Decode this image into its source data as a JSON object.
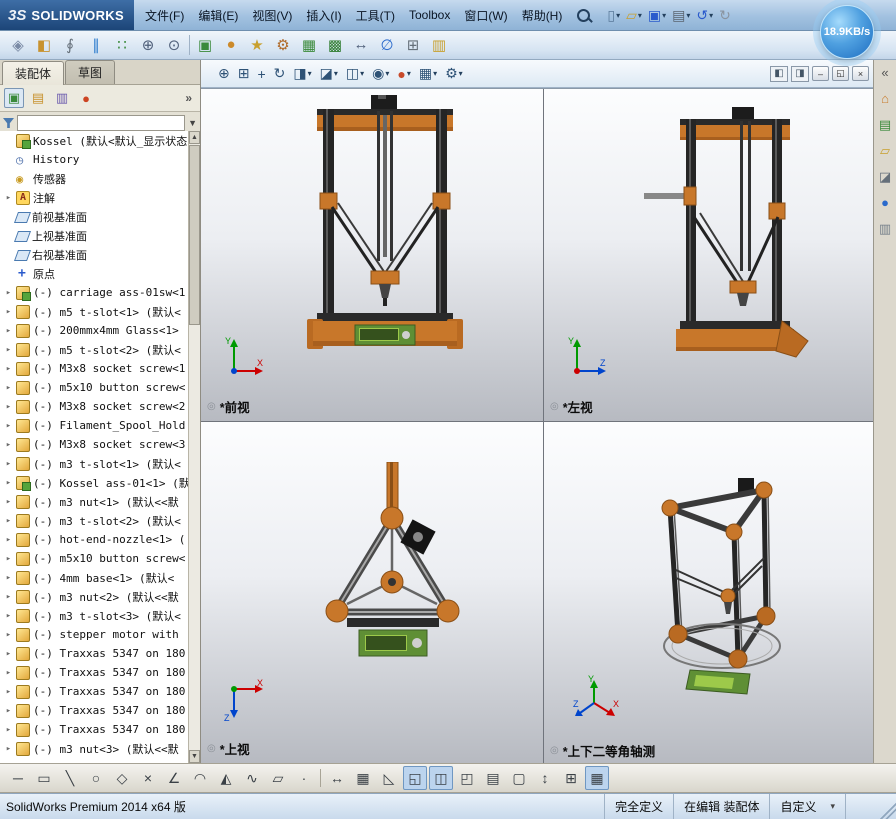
{
  "titlebar": {
    "logo_mark": "3S",
    "logo_text": "SOLIDWORKS",
    "menus": [
      "文件(F)",
      "编辑(E)",
      "视图(V)",
      "插入(I)",
      "工具(T)",
      "Toolbox",
      "窗口(W)",
      "帮助(H)"
    ],
    "quick_icons": [
      {
        "name": "new-document-icon",
        "glyph": "▯",
        "color": "#5a7a9a",
        "caret": true
      },
      {
        "name": "open-icon",
        "glyph": "▱",
        "color": "#c8a02e",
        "caret": true
      },
      {
        "name": "save-icon",
        "glyph": "▣",
        "color": "#2a5acc",
        "caret": true
      },
      {
        "name": "print-icon",
        "glyph": "▤",
        "color": "#5a6470",
        "caret": true
      },
      {
        "name": "undo-icon",
        "glyph": "↺",
        "color": "#2a5acc",
        "caret": true
      },
      {
        "name": "redo-icon",
        "glyph": "↻",
        "color": "#8a94a0",
        "caret": false
      }
    ],
    "speed_badge": "18.9KB/s"
  },
  "main_toolbar": {
    "icons": [
      {
        "name": "smart-explode-icon",
        "glyph": "◈",
        "color": "#7a8aa5"
      },
      {
        "name": "edit-component-icon",
        "glyph": "◧",
        "color": "#c8922e"
      },
      {
        "name": "paperclip-icon",
        "glyph": "∮",
        "color": "#66707a"
      },
      {
        "name": "mate-icon",
        "glyph": "∥",
        "color": "#2a7acc"
      },
      {
        "name": "component-pattern-icon",
        "glyph": "∷",
        "color": "#3a8a3a"
      },
      {
        "name": "magnifier-plus-icon",
        "glyph": "⊕",
        "color": "#50607a"
      },
      {
        "name": "magnifier-icon",
        "glyph": "⊙",
        "color": "#50607a"
      },
      {
        "sep": true
      },
      {
        "name": "insert-component-icon",
        "glyph": "▣",
        "color": "#3a8a3a"
      },
      {
        "name": "appearance-ball-icon",
        "glyph": "●",
        "color": "#cc8a2a"
      },
      {
        "name": "smart-fastener-icon",
        "glyph": "★",
        "color": "#c8a02e"
      },
      {
        "name": "gear-icon",
        "glyph": "⚙",
        "color": "#b06a2a"
      },
      {
        "name": "assembly-feature-icon",
        "glyph": "▦",
        "color": "#3a8a3a"
      },
      {
        "name": "linear-pattern-icon",
        "glyph": "▩",
        "color": "#2a7a2a"
      },
      {
        "name": "move-component-icon",
        "glyph": "↔",
        "color": "#50607a"
      },
      {
        "name": "measure-icon",
        "glyph": "∅",
        "color": "#2a6acc"
      },
      {
        "name": "table-icon",
        "glyph": "⊞",
        "color": "#66707a"
      },
      {
        "name": "instant3d-icon",
        "glyph": "▥",
        "color": "#c8a02e"
      }
    ]
  },
  "left_panel": {
    "tabs": [
      {
        "label": "装配体",
        "active": true
      },
      {
        "label": "草图",
        "active": false
      }
    ],
    "pane_icons": [
      {
        "name": "featuremanager-tab-icon",
        "glyph": "▣",
        "color": "#3a8a3a"
      },
      {
        "name": "propertymanager-tab-icon",
        "glyph": "▤",
        "color": "#c8922e"
      },
      {
        "name": "configurationmanager-tab-icon",
        "glyph": "▥",
        "color": "#6a5aad"
      },
      {
        "name": "displaymanager-tab-icon",
        "glyph": "●",
        "color": "#cc4422"
      }
    ],
    "overflow_chevrons": "»",
    "filter": {
      "value": ""
    },
    "tree": {
      "root": {
        "label": "Kossel (默认<默认_显示状态",
        "icon": "assembly"
      },
      "items": [
        {
          "label": "History",
          "icon": "history"
        },
        {
          "label": "传感器",
          "icon": "sensor"
        },
        {
          "label": "注解",
          "icon": "annotation",
          "expand": true
        },
        {
          "label": "前视基准面",
          "icon": "plane"
        },
        {
          "label": "上视基准面",
          "icon": "plane"
        },
        {
          "label": "右视基准面",
          "icon": "plane"
        },
        {
          "label": "原点",
          "icon": "origin"
        },
        {
          "label": "(-) carriage ass-01sw<1",
          "icon": "assembly",
          "expand": true
        },
        {
          "label": "(-) m5 t-slot<1> (默认<",
          "icon": "part",
          "expand": true
        },
        {
          "label": "(-) 200mmx4mm Glass<1>",
          "icon": "part",
          "expand": true
        },
        {
          "label": "(-) m5 t-slot<2> (默认<",
          "icon": "part",
          "expand": true
        },
        {
          "label": "(-) M3x8 socket screw<1",
          "icon": "part",
          "expand": true
        },
        {
          "label": "(-) m5x10 button screw<",
          "icon": "part",
          "expand": true
        },
        {
          "label": "(-) M3x8 socket screw<2",
          "icon": "part",
          "expand": true
        },
        {
          "label": "(-) Filament_Spool_Hold",
          "icon": "part",
          "expand": true
        },
        {
          "label": "(-) M3x8 socket screw<3",
          "icon": "part",
          "expand": true
        },
        {
          "label": "(-) m3 t-slot<1> (默认<",
          "icon": "part",
          "expand": true
        },
        {
          "label": "(-) Kossel ass-01<1> (默",
          "icon": "assembly",
          "expand": true
        },
        {
          "label": "(-) m3 nut<1> (默认<<默",
          "icon": "part",
          "expand": true
        },
        {
          "label": "(-) m3 t-slot<2> (默认<",
          "icon": "part",
          "expand": true
        },
        {
          "label": "(-) hot-end-nozzle<1> (",
          "icon": "part",
          "expand": true
        },
        {
          "label": "(-) m5x10 button screw<",
          "icon": "part",
          "expand": true
        },
        {
          "label": "(-) 4mm base<1> (默认<",
          "icon": "part",
          "expand": true
        },
        {
          "label": "(-) m3 nut<2> (默认<<默",
          "icon": "part",
          "expand": true
        },
        {
          "label": "(-) m3 t-slot<3> (默认<",
          "icon": "part",
          "expand": true
        },
        {
          "label": "(-) stepper motor with",
          "icon": "part",
          "expand": true
        },
        {
          "label": "(-) Traxxas 5347 on 180",
          "icon": "part",
          "expand": true
        },
        {
          "label": "(-) Traxxas 5347 on 180",
          "icon": "part",
          "expand": true
        },
        {
          "label": "(-) Traxxas 5347 on 180",
          "icon": "part",
          "expand": true
        },
        {
          "label": "(-) Traxxas 5347 on 180",
          "icon": "part",
          "expand": true
        },
        {
          "label": "(-) Traxxas 5347 on 180",
          "icon": "part",
          "expand": true
        },
        {
          "label": "(-) m3 nut<3> (默认<<默",
          "icon": "part",
          "expand": true
        }
      ]
    }
  },
  "viewport": {
    "toolbar_icons": [
      {
        "name": "zoom-fit-icon",
        "glyph": "⊕"
      },
      {
        "name": "zoom-area-icon",
        "glyph": "⊞"
      },
      {
        "name": "pan-icon",
        "glyph": "+"
      },
      {
        "name": "rotate-view-icon",
        "glyph": "↻"
      },
      {
        "name": "view-orientation-icon",
        "glyph": "◨",
        "caret": true
      },
      {
        "name": "section-view-icon",
        "glyph": "◪",
        "caret": true
      },
      {
        "name": "display-style-icon",
        "glyph": "◫",
        "caret": true
      },
      {
        "name": "hide-show-items-icon",
        "glyph": "◉",
        "caret": true
      },
      {
        "name": "edit-appearance-icon",
        "glyph": "●",
        "color": "#c84a2a",
        "caret": true
      },
      {
        "name": "apply-scene-icon",
        "glyph": "▦",
        "caret": true
      },
      {
        "name": "view-settings-icon",
        "glyph": "⚙",
        "caret": true
      }
    ],
    "tab_icons": [
      {
        "name": "viewport-left-icon",
        "glyph": "◧"
      },
      {
        "name": "viewport-right-icon",
        "glyph": "◨"
      }
    ],
    "window_icons": [
      {
        "name": "doc-minimize-button",
        "glyph": "–"
      },
      {
        "name": "doc-restore-button",
        "glyph": "◱"
      },
      {
        "name": "doc-close-button",
        "glyph": "×"
      }
    ],
    "views": [
      {
        "label": "*前视"
      },
      {
        "label": "*左视"
      },
      {
        "label": "*上视"
      },
      {
        "label": "*上下二等角轴测"
      }
    ]
  },
  "right_rail": {
    "icons": [
      {
        "name": "collapse-pane-icon",
        "glyph": "«",
        "color": "#555"
      },
      {
        "name": "home-icon",
        "glyph": "⌂",
        "color": "#c87d2e"
      },
      {
        "name": "design-library-icon",
        "glyph": "▤",
        "color": "#3a8a3a"
      },
      {
        "name": "file-explorer-icon",
        "glyph": "▱",
        "color": "#c8a02e"
      },
      {
        "name": "toolbox-icon",
        "glyph": "◪",
        "color": "#66707a"
      },
      {
        "name": "appearances-icon",
        "glyph": "●",
        "color": "#2a6acc"
      },
      {
        "name": "custom-properties-icon",
        "glyph": "▥",
        "color": "#76808a"
      }
    ]
  },
  "bottom_toolbar": {
    "icons": [
      {
        "name": "centerline-icon",
        "glyph": "─"
      },
      {
        "name": "rectangle-icon",
        "glyph": "▭"
      },
      {
        "name": "line-icon",
        "glyph": "╲"
      },
      {
        "name": "circle-icon",
        "glyph": "○"
      },
      {
        "name": "polygon-icon",
        "glyph": "◇"
      },
      {
        "name": "trim-icon",
        "glyph": "×"
      },
      {
        "name": "angle-icon",
        "glyph": "∠"
      },
      {
        "name": "arc-icon",
        "glyph": "◠"
      },
      {
        "name": "offset-icon",
        "glyph": "◭"
      },
      {
        "name": "spline-icon",
        "glyph": "∿"
      },
      {
        "name": "plane-icon",
        "glyph": "▱"
      },
      {
        "name": "point-icon",
        "glyph": "·"
      },
      {
        "sep": true
      },
      {
        "name": "smart-dimension-icon",
        "glyph": "↔"
      },
      {
        "name": "grid-icon",
        "glyph": "▦"
      },
      {
        "name": "chamfer-icon",
        "glyph": "◺"
      },
      {
        "name": "single-view-icon",
        "glyph": "◱",
        "active": true
      },
      {
        "name": "four-view-icon",
        "glyph": "◫",
        "active": true,
        "caret": true
      },
      {
        "name": "display-mode-icon",
        "glyph": "◰",
        "caret": true
      },
      {
        "name": "shaded-icon",
        "glyph": "▤"
      },
      {
        "name": "wireframe-icon",
        "glyph": "▢"
      },
      {
        "name": "updown-icon",
        "glyph": "↕"
      },
      {
        "name": "grid-snap-icon",
        "glyph": "⊞"
      },
      {
        "name": "viewport-grid-icon",
        "glyph": "▦",
        "active": true
      }
    ]
  },
  "statusbar": {
    "product": "SolidWorks Premium 2014 x64 版",
    "define_state": "完全定义",
    "edit_state": "在编辑 装配体",
    "custom": "自定义"
  },
  "colors": {
    "accent_orange": "#c8772a",
    "lcd_green": "#9dc94a",
    "frame_dark": "#252525",
    "badge_blue": "#1c6cc0"
  }
}
